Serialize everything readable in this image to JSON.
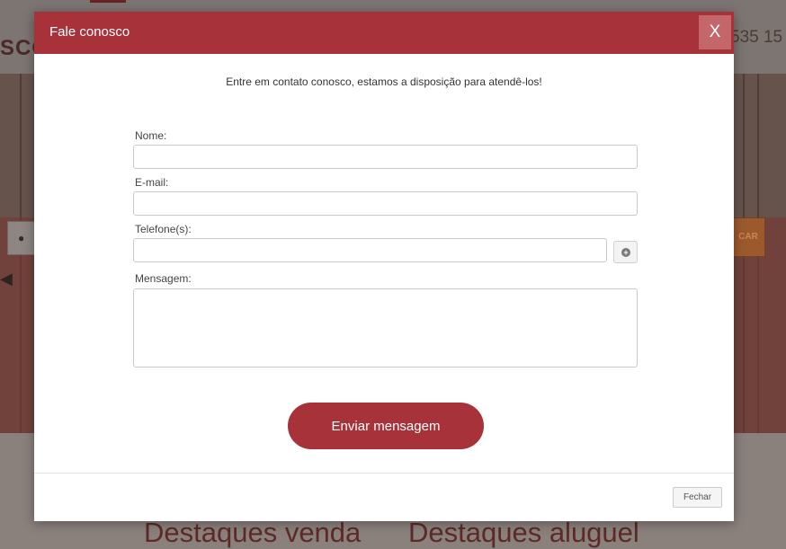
{
  "background": {
    "brand_text": "SCO",
    "phone_fragment": "535 15",
    "search_button_text": "CAR",
    "destaques_venda": "Destaques venda",
    "destaques_aluguel": "Destaques aluguel"
  },
  "modal": {
    "title": "Fale conosco",
    "close_label": "X",
    "intro": "Entre em contato conosco, estamos a disposição para atendê-los!",
    "fields": {
      "nome_label": "Nome:",
      "nome_value": "",
      "email_label": "E-mail:",
      "email_value": "",
      "telefone_label": "Telefone(s):",
      "telefone_value": "",
      "add_phone_symbol": "+",
      "mensagem_label": "Mensagem:",
      "mensagem_value": ""
    },
    "send_label": "Enviar mensagem",
    "footer_close_label": "Fechar"
  },
  "icons": {
    "location": "map-pin-icon",
    "add_phone": "plus-circle-icon",
    "close": "close-icon"
  },
  "colors": {
    "accent": "#a7323a",
    "close_button": "#c3676b"
  }
}
